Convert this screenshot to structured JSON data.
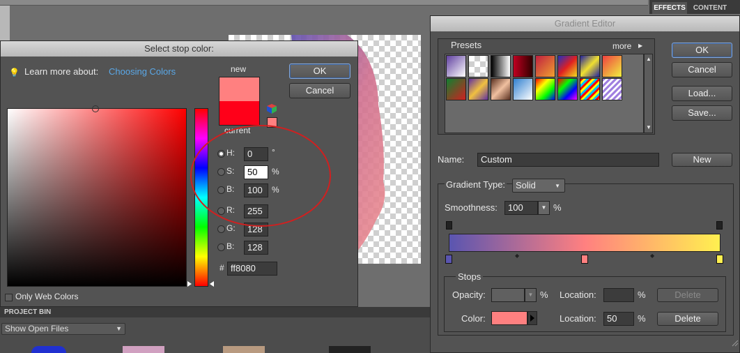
{
  "effects_panel": {
    "tab_effects": "EFFECTS",
    "tab_content": "CONTENT"
  },
  "stop_color_dialog": {
    "title": "Select stop color:",
    "learn_more_label": "Learn more about:",
    "learn_more_link": "Choosing Colors",
    "new_label": "new",
    "current_label": "current",
    "ok": "OK",
    "cancel": "Cancel",
    "fields": {
      "h": {
        "label": "H:",
        "value": "0",
        "unit": "°"
      },
      "s": {
        "label": "S:",
        "value": "50",
        "unit": "%"
      },
      "b": {
        "label": "B:",
        "value": "100",
        "unit": "%"
      },
      "r": {
        "label": "R:",
        "value": "255"
      },
      "g": {
        "label": "G:",
        "value": "128"
      },
      "bl": {
        "label": "B:",
        "value": "128"
      },
      "hex_label": "#",
      "hex": "ff8080"
    },
    "only_web_colors": "Only Web Colors",
    "colors": {
      "new": "#ff8080",
      "current": "#ff0019"
    }
  },
  "project_bin": {
    "label": "PROJECT BIN",
    "dropdown": "Show Open Files"
  },
  "gradient_editor": {
    "title": "Gradient Editor",
    "presets_label": "Presets",
    "more_label": "more",
    "ok": "OK",
    "cancel": "Cancel",
    "load": "Load...",
    "save": "Save...",
    "name_label": "Name:",
    "name_value": "Custom",
    "new_button": "New",
    "gradient_type_label": "Gradient Type:",
    "gradient_type_value": "Solid",
    "smoothness_label": "Smoothness:",
    "smoothness_value": "100",
    "smoothness_unit": "%",
    "stops_label": "Stops",
    "opacity_label": "Opacity:",
    "opacity_unit": "%",
    "location_label": "Location:",
    "location_unit": "%",
    "delete": "Delete",
    "color_label": "Color:",
    "color_location_label": "Location:",
    "color_location_value": "50",
    "color_location_unit": "%",
    "delete2": "Delete",
    "stop_color": "#ff8080",
    "gradient_colors": [
      "#5a55b0",
      "#ff8080",
      "#fff050"
    ]
  }
}
